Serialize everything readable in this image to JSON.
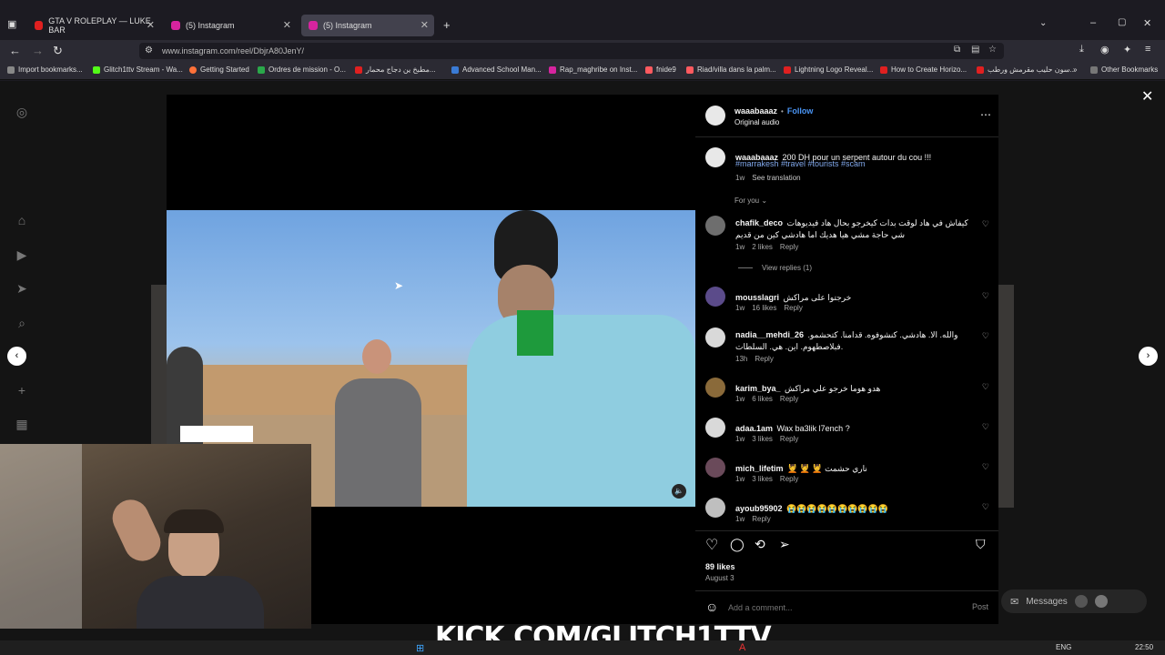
{
  "browser": {
    "tabs": [
      {
        "label": "GTA V ROLEPLAY — LUKE BAR",
        "active": false
      },
      {
        "label": "(5) Instagram",
        "active": false
      },
      {
        "label": "(5) Instagram",
        "active": true
      }
    ],
    "url": "www.instagram.com/reel/DbjrA80JenY/",
    "bookmarks": [
      "Import bookmarks...",
      "Glitch1ttv Stream - Wa...",
      "Getting Started",
      "Ordres de mission - O...",
      "مطبخ ين دجاج محمار...",
      "Advanced School Man...",
      "Rap_maghribe on Inst...",
      "fnide9",
      "Riad/villa dans la palm...",
      "Lightning Logo Reveal...",
      "How to Create Horizo...",
      "سون حليب مقرمش ورطب...",
      "Other Bookmarks"
    ]
  },
  "post": {
    "author": "waaabaaaz",
    "follow_label": "Follow",
    "dot": "•",
    "audio": "Original audio",
    "caption_user": "waaabaaaz",
    "caption_text": "200 DH pour un serpent autour du cou !!!",
    "hashtags": "#marrakesh #travel #tourists #scam",
    "caption_time": "1w",
    "see_translation": "See translation",
    "sort_label": "For you",
    "likes": "89 likes",
    "date": "August 3",
    "add_comment_placeholder": "Add a comment...",
    "post_label": "Post"
  },
  "comments": [
    {
      "user": "chafik_deco",
      "text": "كيفاش في هاد لوقت بدات كيخرجو بحال هاد فيديوهات شي حاجة مشي هيا هديك اما هادشي كين من قديم",
      "time": "1w",
      "likes": "2 likes",
      "reply": "Reply",
      "view_replies": "View replies (1)"
    },
    {
      "user": "mousslagri",
      "text": "خرجتوا على مراكش",
      "time": "1w",
      "likes": "16 likes",
      "reply": "Reply"
    },
    {
      "user": "nadia__mehdi_26",
      "text": "والله. الا. هادشي. كنشوفوه. قدامنا. كتحشمو. فبلاصطهوم. اين. هي. السلطات.",
      "time": "13h",
      "likes": "",
      "reply": "Reply"
    },
    {
      "user": "karim_bya_",
      "text": "هدو هوما خرجو علي مراكش",
      "time": "1w",
      "likes": "6 likes",
      "reply": "Reply"
    },
    {
      "user": "adaa.1am",
      "text": "Wax ba3lik l7ench ?",
      "time": "1w",
      "likes": "3 likes",
      "reply": "Reply"
    },
    {
      "user": "mich_lifetim",
      "text": "💆 💆 💆 ناري حشمت",
      "time": "1w",
      "likes": "3 likes",
      "reply": "Reply"
    },
    {
      "user": "ayoub95902",
      "text": "😭😭😭😭😭😭😭😭😭😭",
      "time": "1w",
      "likes": "",
      "reply": "Reply"
    }
  ],
  "messages_label": "Messages",
  "overlay_text": "KICK.COM/GLITCH1TTV",
  "taskbar": {
    "lang": "ENG",
    "time": "22:50"
  }
}
